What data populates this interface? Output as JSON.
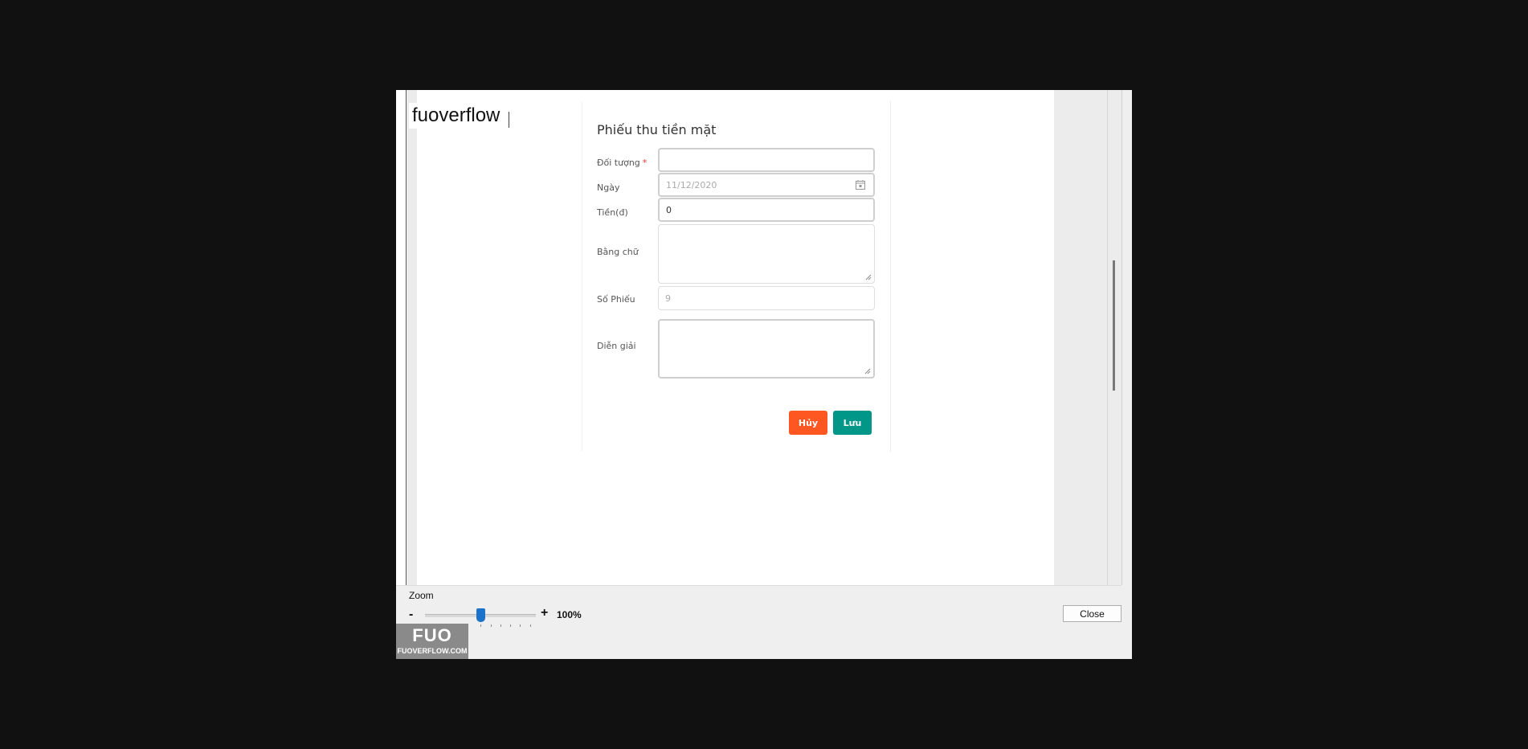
{
  "watermark": {
    "text": "fuoverflow"
  },
  "form": {
    "title": "Phiếu thu tiền mặt",
    "fields": [
      {
        "label": "Đối tượng",
        "required_mark": "*",
        "value": ""
      },
      {
        "label": "Ngày",
        "value": "11/12/2020",
        "icon": "calendar-icon"
      },
      {
        "label": "Tiền(đ)",
        "value": "0"
      },
      {
        "label": "Bằng chữ",
        "value": ""
      },
      {
        "label": "Số Phiếu",
        "value": "9"
      },
      {
        "label": "Diễn giải",
        "value": ""
      }
    ],
    "buttons": {
      "cancel": "Hủy",
      "save": "Lưu"
    },
    "colors": {
      "cancel": "#ff5722",
      "save": "#009688",
      "required": "#e53935"
    }
  },
  "zoom": {
    "label": "Zoom",
    "minus": "-",
    "plus": "+",
    "value_label": "100%",
    "level": 100
  },
  "footer": {
    "close_label": "Close",
    "logo_main": "FUO",
    "logo_sub": "FUOVERFLOW.COM"
  }
}
